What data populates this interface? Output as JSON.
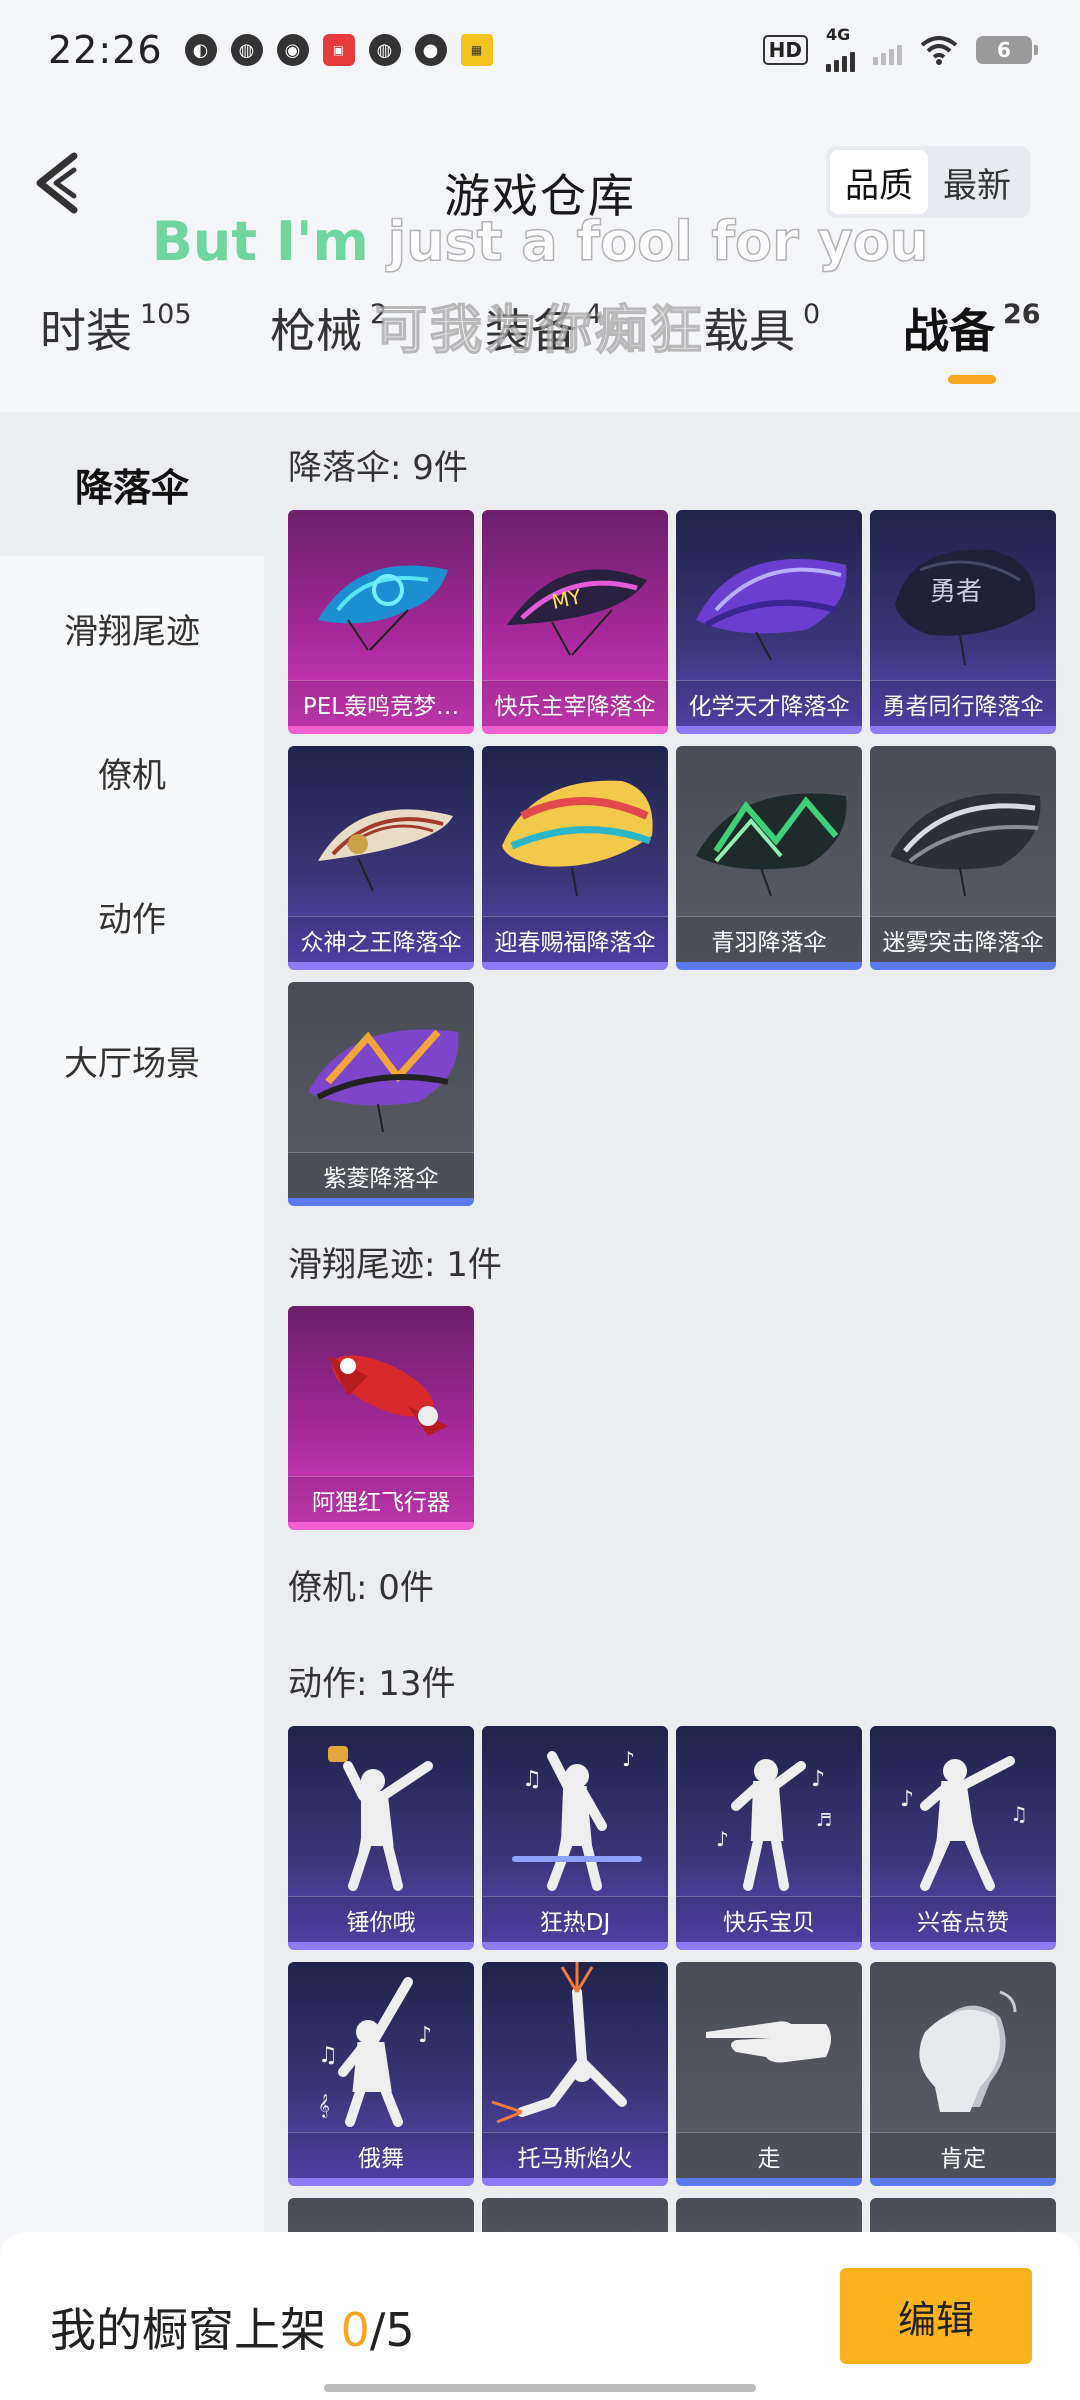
{
  "status": {
    "time": "22:26",
    "battery": "6",
    "network": "4G"
  },
  "header": {
    "title": "游戏仓库",
    "sort_options": [
      "品质",
      "最新"
    ],
    "sort_active": "品质"
  },
  "lyrics": {
    "en_highlight": "But I'm",
    "en_rest": " just a fool for you",
    "zh": "可我为你痴狂"
  },
  "tabs": [
    {
      "label": "时装",
      "count": "105"
    },
    {
      "label": "枪械",
      "count": "2"
    },
    {
      "label": "装备",
      "count": "4"
    },
    {
      "label": "载具",
      "count": "0"
    },
    {
      "label": "战备",
      "count": "26"
    }
  ],
  "active_tab": "战备",
  "sidebar": {
    "items": [
      "降落伞",
      "滑翔尾迹",
      "僚机",
      "动作",
      "大厅场景"
    ],
    "active": "降落伞"
  },
  "sections": {
    "parachute": {
      "title": "降落伞: 9件",
      "items": [
        "PEL轰鸣竞梦…",
        "快乐主宰降落伞",
        "化学天才降落伞",
        "勇者同行降落伞",
        "众神之王降落伞",
        "迎春赐福降落伞",
        "青羽降落伞",
        "迷雾突击降落伞",
        "紫菱降落伞"
      ]
    },
    "glide_trail": {
      "title": "滑翔尾迹: 1件",
      "items": [
        "阿狸红飞行器"
      ]
    },
    "wingman": {
      "title": "僚机: 0件"
    },
    "emote": {
      "title": "动作: 13件",
      "items": [
        "锤你哦",
        "狂热DJ",
        "快乐宝贝",
        "兴奋点赞",
        "俄舞",
        "托马斯焰火",
        "走",
        "肯定"
      ]
    }
  },
  "bottom": {
    "shelf_label": "我的橱窗上架 ",
    "shelf_current": "0",
    "shelf_total": "/5",
    "edit_label": "编辑"
  },
  "colors": {
    "accent": "#f5a623",
    "edit_button": "#fdb31f",
    "rarity_pink": "#d43cc0",
    "rarity_purple": "#5a47b8",
    "rarity_grey": "#5a5d65"
  }
}
